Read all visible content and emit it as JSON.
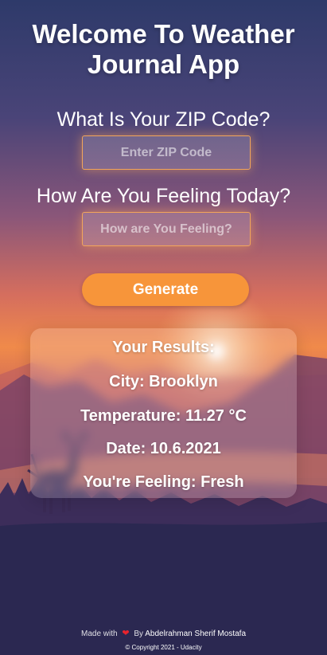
{
  "header": {
    "title_line1": "Welcome To Weather",
    "title_line2": "Journal App"
  },
  "form": {
    "zip_label": "What Is Your ZIP Code?",
    "zip_placeholder": "Enter ZIP Code",
    "feelings_label": "How Are You Feeling Today?",
    "feelings_placeholder": "How are You Feeling?",
    "generate_label": "Generate"
  },
  "results": {
    "heading": "Your Results:",
    "city": "City: Brooklyn",
    "temperature": "Temperature: 11.27 °C",
    "date": "Date: 10.6.2021",
    "feeling": "You're Feeling: Fresh"
  },
  "footer": {
    "made_with": "Made with",
    "by": "By",
    "author": "Abdelrahman Sherif Mostafa",
    "heart_icon": "heart-icon",
    "copyright": "© Copyright 2021 - Udacity"
  },
  "colors": {
    "accent": "#f7953a",
    "input_border": "#f2a55a",
    "heart": "#e8232d",
    "sky_top": "#2e3a6a",
    "sky_horizon": "#f08a4a"
  }
}
